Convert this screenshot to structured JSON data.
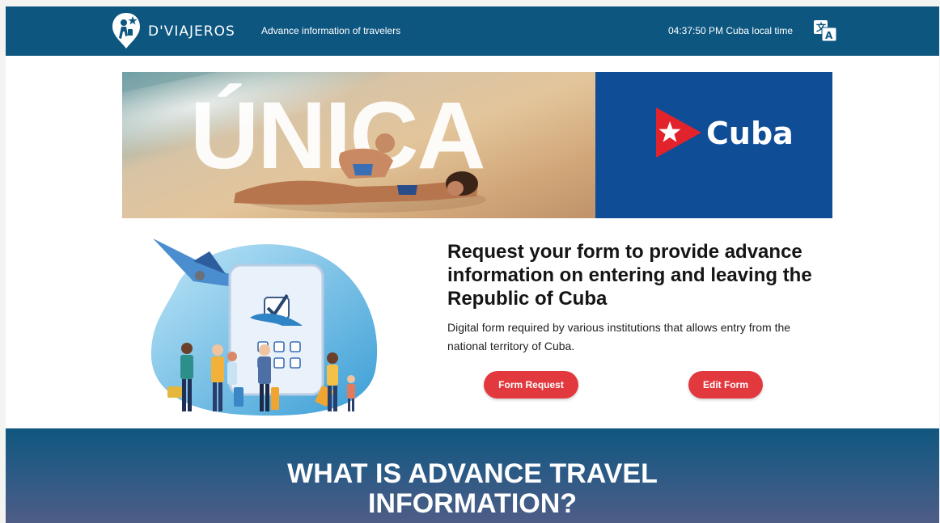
{
  "header": {
    "brand": "D'VIAJEROS",
    "subtitle": "Advance information of travelers",
    "clock": "04:37:50 PM Cuba local time",
    "logo_icon": "traveler-logo-icon",
    "language_icon": "translate-icon"
  },
  "banner": {
    "headline": "ÚNICA",
    "destination": "Cuba",
    "flag_icon": "cuba-flag-icon"
  },
  "hero": {
    "title": "Request your form to provide advance information on entering and leaving the Republic of Cuba",
    "description": "Digital form required by various institutions that allows entry from the national territory of Cuba.",
    "request_button": "Form Request",
    "edit_button": "Edit Form"
  },
  "info": {
    "title_line1": "WHAT IS ADVANCE TRAVEL",
    "title_line2": "INFORMATION?"
  },
  "colors": {
    "header_bg": "#0d5680",
    "accent_button": "#e2393f",
    "banner_blue": "#0f4d97"
  }
}
